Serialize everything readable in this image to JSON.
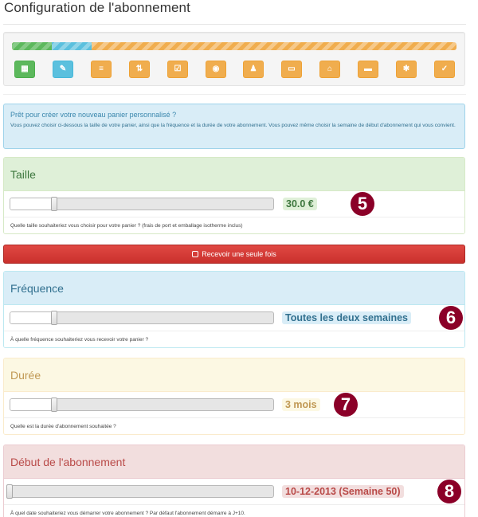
{
  "page": {
    "title": "Configuration de l'abonnement"
  },
  "wizard": {
    "progress": {
      "completed_fraction": 0.09,
      "current_fraction": 0.09
    },
    "steps": [
      {
        "icon": "grid-icon",
        "glyph": "▦",
        "color": "green"
      },
      {
        "icon": "wrench-icon",
        "glyph": "✎",
        "color": "blue"
      },
      {
        "icon": "list-icon",
        "glyph": "≡",
        "color": "orange"
      },
      {
        "icon": "sort-icon",
        "glyph": "⇅",
        "color": "orange"
      },
      {
        "icon": "check-square-icon",
        "glyph": "☑",
        "color": "orange"
      },
      {
        "icon": "eye-icon",
        "glyph": "◉",
        "color": "orange"
      },
      {
        "icon": "user-icon",
        "glyph": "♟",
        "color": "orange"
      },
      {
        "icon": "card-icon",
        "glyph": "▭",
        "color": "orange"
      },
      {
        "icon": "home-icon",
        "glyph": "⌂",
        "color": "orange"
      },
      {
        "icon": "comment-icon",
        "glyph": "▬",
        "color": "orange"
      },
      {
        "icon": "asterisk-icon",
        "glyph": "✱",
        "color": "orange"
      },
      {
        "icon": "checkbox-icon",
        "glyph": "✓",
        "color": "orange"
      }
    ]
  },
  "intro": {
    "title": "Prêt pour créer votre nouveau panier personnalisé ?",
    "text": "Vous pouvez choisir ci-dessous la taille de votre panier, ainsi que la fréquence et la durée de votre abonnement. Vous pouvez même choisir la semaine de début d'abonnement qui vous convient."
  },
  "taille": {
    "heading": "Taille",
    "value_label": "30.0 €",
    "slider_fraction": 0.17,
    "help": "Quelle taille souhaiteriez vous choisir pour votre panier ? (frais de port et emballage isotherme inclus)",
    "badge": "5"
  },
  "single_delivery_button": {
    "label": "Recevoir une seule fois"
  },
  "frequence": {
    "heading": "Fréquence",
    "value_label": "Toutes les deux semaines",
    "slider_fraction": 0.17,
    "help": "À quelle fréquence souhaiteriez vous recevoir votre panier ?",
    "badge": "6"
  },
  "duree": {
    "heading": "Durée",
    "value_label": "3 mois",
    "slider_fraction": 0.17,
    "help": "Quelle est la durée d'abonnement souhaitée ?",
    "badge": "7"
  },
  "debut": {
    "heading": "Début de l'abonnement",
    "value_label": "10-12-2013 (Semaine 50)",
    "slider_fraction": 0.0,
    "help": "À quel date souhaiteriez vous démarrer votre abonnement ? Par défaut l'abonnement démarre à J+10.",
    "badge": "8"
  },
  "colors": {
    "success": "#5cb85c",
    "info": "#5bc0de",
    "warning": "#f0ad4e",
    "danger": "#d9534f",
    "badge": "#8b0028"
  }
}
